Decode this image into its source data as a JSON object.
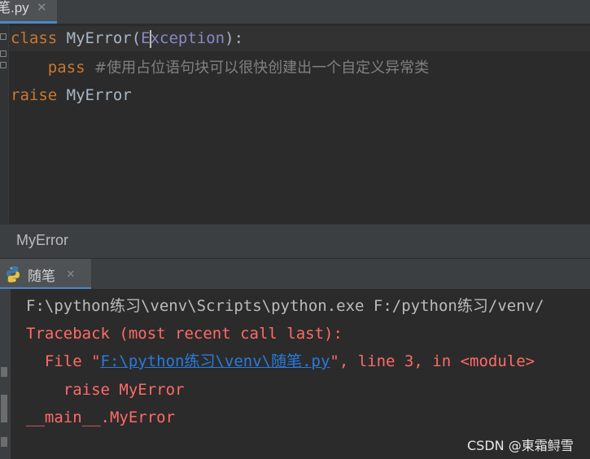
{
  "editor_tab": {
    "label": "笔.py",
    "close": "✕"
  },
  "code": {
    "line1": {
      "kw": "class",
      "name": " MyError(",
      "exc_a": "E",
      "exc_b": "xception",
      "end": "):"
    },
    "line2": {
      "kw": "pass",
      "comment": "#使用占位语句块可以很快创建出一个自定义异常类"
    },
    "line3": {
      "kw": "raise",
      "name": " MyError"
    }
  },
  "breadcrumb": "MyError",
  "run_tab": {
    "label": "随笔",
    "close": "✕",
    "icon": "python-icon"
  },
  "console": {
    "cmd": "F:\\python练习\\venv\\Scripts\\python.exe F:/python练习/venv/",
    "traceback": "Traceback (most recent call last):",
    "file_prefix": "  File \"",
    "file_link": "F:\\python练习\\venv\\随笔.py",
    "file_suffix": "\", line 3, in <module>",
    "raise_line": "    raise MyError",
    "error_line": "__main__.MyError"
  },
  "watermark": "CSDN @東霜鲟雪",
  "colors": {
    "keyword": "#cc7832",
    "error": "#ff6b68",
    "link": "#287bde",
    "comment": "#808080",
    "accent": "#4a88c7"
  }
}
